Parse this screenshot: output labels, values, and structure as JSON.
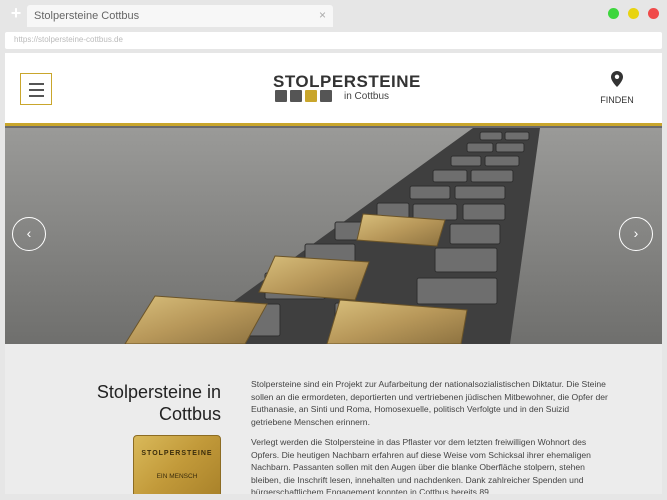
{
  "browser": {
    "tab_title": "Stolpersteine Cottbus",
    "tab_close": "×",
    "new_tab": "+",
    "url": "https://stolpersteine-cottbus.de"
  },
  "header": {
    "logo_title": "STOLPERSTEINE",
    "logo_subtitle": "in Cottbus",
    "logo_colors": [
      "#555555",
      "#555555",
      "#c9a62c",
      "#555555"
    ],
    "find_label": "FINDEN",
    "find_icon": "map-pin-icon",
    "menu_icon": "hamburger-icon"
  },
  "colors": {
    "accent": "#c9a62c",
    "dark": "#555555"
  },
  "slider": {
    "prev": "‹",
    "next": "›"
  },
  "content": {
    "title": "Stolpersteine in Cottbus",
    "paragraph1": "Stolpersteine sind ein Projekt zur Aufarbeitung der nationalsozialistischen Diktatur. Die Steine sollen an die ermordeten, deportierten und vertriebenen jüdischen Mitbewohner, die Opfer der Euthanasie, an Sinti und Roma, Homosexuelle, politisch Verfolgte und in den Suizid getriebene Menschen erinnern.",
    "paragraph2": "Verlegt werden die Stolpersteine in das Pflaster vor dem letzten freiwilligen Wohnort des Opfers. Die heutigen Nachbarn erfahren auf diese Weise vom Schicksal ihrer ehemaligen Nachbarn. Passanten sollen mit den Augen über die blanke Oberfläche stolpern, stehen bleiben, die Inschrift lesen, innehalten und nachdenken. Dank zahlreicher Spenden und bürgerschaftlichem Engagement konnten in Cottbus bereits 89",
    "stone_line1": "STOLPERSTEINE",
    "stone_line2": "EIN MENSCH"
  }
}
